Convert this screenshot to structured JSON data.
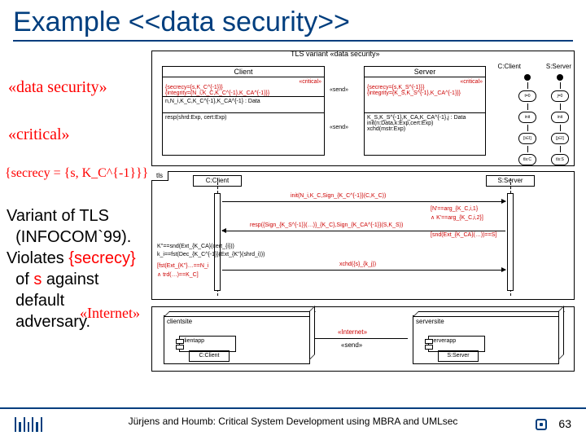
{
  "title": "Example <<data security>>",
  "annotations": {
    "datasec": "«data security»",
    "critical": "«critical»",
    "secrecy": "{secrecy = {s, K_C^{-1}}}",
    "internet": "«Internet»"
  },
  "top_diagram": {
    "label": "TLS variant   «data security»",
    "client_title": "Client",
    "client_tag_critical": "«critical»",
    "client_secrecy": "{secrecy={s,K_C^{-1}}}",
    "client_integrity": "{integrity={N_i,K_C,K_C^{-1},K_CA^{-1}}}",
    "client_row2": "n,N_i,K_C,K_C^{-1},K_CA^{-1} : Data",
    "client_row3": "resp(shrd:Exp, cert:Exp)",
    "server_title": "Server",
    "server_tag_critical": "«critical»",
    "server_secrecy": "{secrecy={s,K_S^{-1}}}",
    "server_integrity": "{integrity={K_S,K_S^{-1},K_CA^{-1}}}",
    "server_row2a": "K_S,K_S^{-1},K_CA,K_CA^{-1},j : Data",
    "server_row2b": "init(n:Data,k:Exp,cert:Exp)",
    "server_row2c": "xchd(mstr:Exp)",
    "sm_client": "C:Client",
    "sm_server": "S:Server",
    "sm_states": [
      "t=0",
      "init",
      "[i∈I]",
      "tls:C"
    ],
    "sm_states2": [
      "j=0",
      "init",
      "[j∈I]",
      "tls:S"
    ],
    "snd": "«send»"
  },
  "seq": {
    "tab": "tls",
    "left": "C:Client",
    "right": "S:Server",
    "msg1": "init(N_i,K_C,Sign_{K_C^{-1}}(C,K_C))",
    "msg2a": "[N'==arg_{K_C,i,1}",
    "msg2b": "∧ K'==arg_{K_C,i,2}]",
    "msg3": "resp({Sign_{K_S^{-1}}(…)}_{K_C},Sign_{K_CA^{-1}}(S,K_S))",
    "msg3b": "[snd(Ext_{K_CA}(…))==S]",
    "msg4": "xchd({s}_{k_j})",
    "left_note1": "K''==snd(Ext_{K_CA}(cert_{i}))",
    "left_note2": "k_i==fst(Dec_{K_C^{-1}}(Ext_{K''}(shrd_i)))",
    "left_note3": "[fst(Ext_{K''}…==N_i",
    "left_note4": "∧ trd(…)==K_C]"
  },
  "dep": {
    "node1": "clientsite",
    "node2": "serversite",
    "comp1": "clientapp",
    "comp2": "serverapp",
    "inner1": "C:Client",
    "inner2": "S:Server",
    "link": "«Internet»",
    "snd": "«send»"
  },
  "body": {
    "l1": "Variant of TLS",
    "l2": "(INFOCOM`99).",
    "l3a": "Violates ",
    "l3b": "{secrecy}",
    "l4a": "of ",
    "l4b": "s",
    "l4c": " against",
    "l5": "default",
    "l6": "adversary."
  },
  "footer": {
    "text": "Jürjens and Houmb: Critical System Development using MBRA and UMLsec",
    "page": "63"
  }
}
